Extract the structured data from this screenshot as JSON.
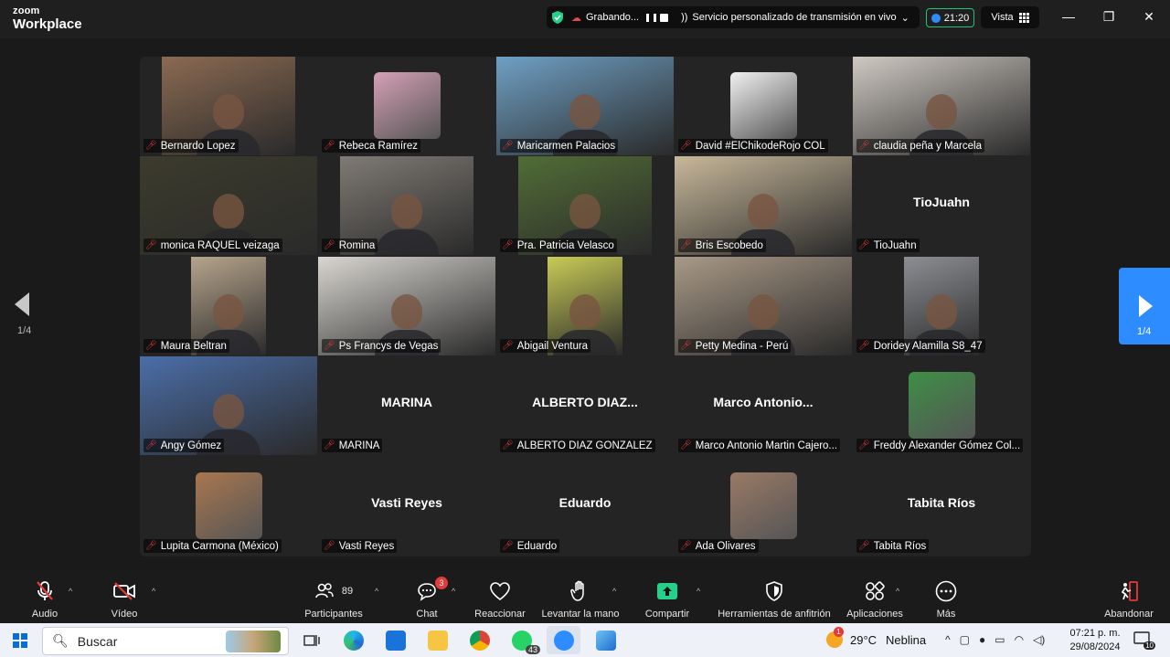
{
  "app": {
    "logo_line1": "zoom",
    "logo_line2": "Workplace",
    "recording_label": "Grabando...",
    "stream_label": "Servicio personalizado de transmisión en vivo",
    "stream_caret": "⌄",
    "timer": "21:20",
    "view_label": "Vista",
    "window_controls": {
      "minimize": "—",
      "restore": "❐",
      "close": "✕"
    }
  },
  "pagination": {
    "prev_page": "1/4",
    "next_page": "1/4"
  },
  "participants": [
    {
      "name": "Bernardo Lopez",
      "kind": "video",
      "bg": "#8b6a52",
      "active": false
    },
    {
      "name": "Rebeca Ramírez",
      "kind": "photo",
      "bg": "#d6a0b6",
      "active": false
    },
    {
      "name": "Maricarmen Palacios",
      "kind": "video",
      "bg": "#6fa0c4",
      "active": false
    },
    {
      "name": "David #ElChikodeRojo COL",
      "kind": "photo",
      "bg": "#f1f1f1",
      "active": false
    },
    {
      "name": "claudia peña y Marcela",
      "kind": "video",
      "bg": "#cfc9c2",
      "active": false
    },
    {
      "name": "monica RAQUEL veizaga",
      "kind": "video",
      "bg": "#3c3b2c",
      "active": false
    },
    {
      "name": "Romina",
      "kind": "video",
      "bg": "#7f7a74",
      "active": false
    },
    {
      "name": "Pra. Patricia Velasco",
      "kind": "video",
      "bg": "#516d36",
      "active": false
    },
    {
      "name": "Bris Escobedo",
      "kind": "video",
      "bg": "#c8b89a",
      "active": false
    },
    {
      "name": "TioJuahn",
      "kind": "text",
      "display": "TioJuahn",
      "active": false
    },
    {
      "name": "Maura Beltran",
      "kind": "video",
      "bg": "#b6a48c",
      "active": false
    },
    {
      "name": "Ps Francys de Vegas",
      "kind": "video",
      "bg": "#d9d6d1",
      "active": true
    },
    {
      "name": "Abigail Ventura",
      "kind": "video",
      "bg": "#c9cb56",
      "active": false
    },
    {
      "name": "Petty Medina - Perú",
      "kind": "video",
      "bg": "#a99987",
      "active": false
    },
    {
      "name": "Doridey Alamilla S8_47",
      "kind": "video",
      "bg": "#8c8e93",
      "active": false
    },
    {
      "name": "Angy Gómez",
      "kind": "video",
      "bg": "#4b6ea8",
      "active": false
    },
    {
      "name": "MARINA",
      "kind": "text",
      "display": "MARINA",
      "active": false
    },
    {
      "name": "ALBERTO DIAZ GONZALEZ",
      "kind": "text",
      "display": "ALBERTO DIAZ...",
      "active": false
    },
    {
      "name": "Marco Antonio Martin Cajero...",
      "kind": "text",
      "display": "Marco  Antonio...",
      "active": false
    },
    {
      "name": "Freddy Alexander Gómez Col...",
      "kind": "photo",
      "bg": "#3e8f46",
      "active": false
    },
    {
      "name": "Lupita Carmona (México)",
      "kind": "photo",
      "bg": "#a9774f",
      "active": false
    },
    {
      "name": "Vasti Reyes",
      "kind": "text",
      "display": "Vasti Reyes",
      "active": false
    },
    {
      "name": "Eduardo",
      "kind": "text",
      "display": "Eduardo",
      "active": false
    },
    {
      "name": "Ada Olivares",
      "kind": "photo",
      "bg": "#9a7a66",
      "active": false
    },
    {
      "name": "Tabita Ríos",
      "kind": "text",
      "display": "Tabita Ríos",
      "active": false
    }
  ],
  "toolbar": {
    "audio": "Audio",
    "video": "Vídeo",
    "participants": "Participantes",
    "participants_count": "89",
    "chat": "Chat",
    "chat_badge": "3",
    "react": "Reaccionar",
    "raise_hand": "Levantar la mano",
    "share": "Compartir",
    "host_tools": "Herramientas de anfitrión",
    "apps": "Aplicaciones",
    "more": "Más",
    "leave": "Abandonar"
  },
  "taskbar": {
    "search_placeholder": "Buscar",
    "whatsapp_badge": "43",
    "weather_temp": "29°C",
    "weather_desc": "Neblina",
    "weather_badge": "1",
    "time": "07:21 p. m.",
    "date": "29/08/2024",
    "notif_count": "10"
  },
  "colors": {
    "accent_blue": "#2d8cff",
    "active_speaker": "#23d18b",
    "share_green": "#23d18b",
    "leave_red": "#e43a3a",
    "mic_muted": "#e03c3c"
  }
}
